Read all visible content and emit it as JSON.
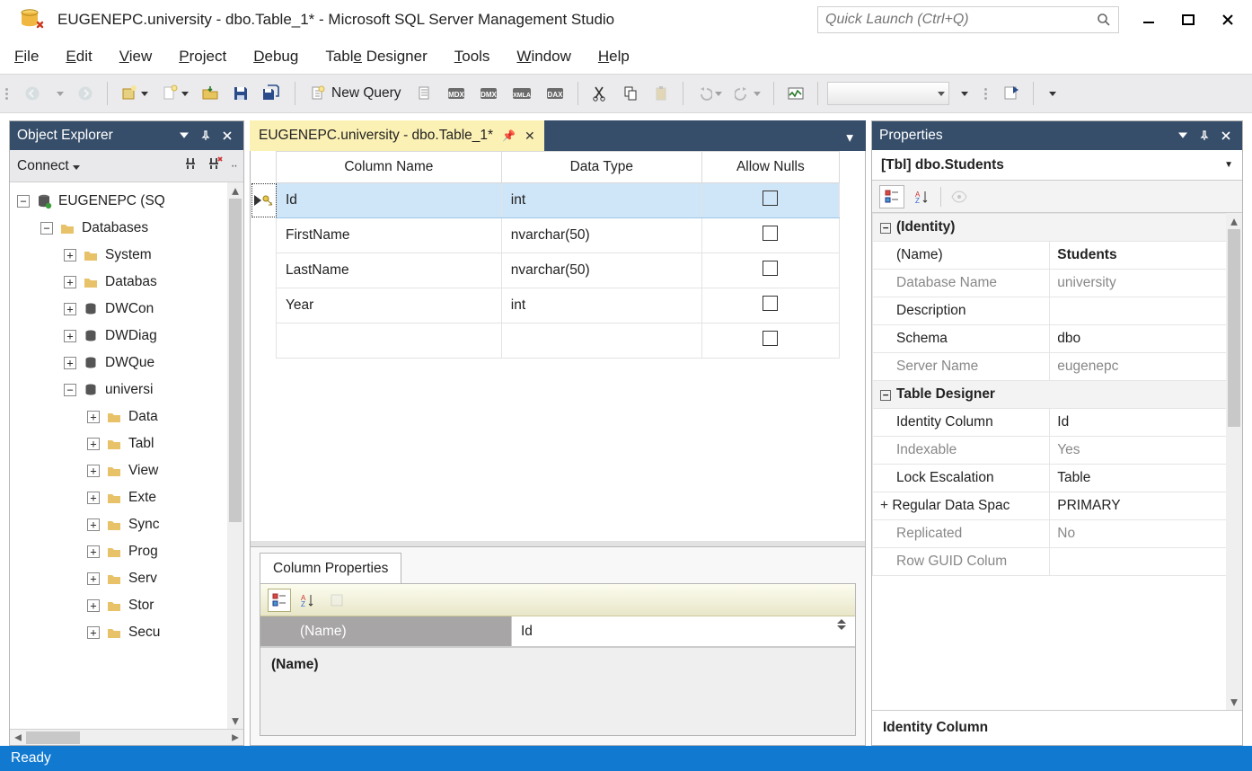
{
  "window": {
    "title": "EUGENEPC.university - dbo.Table_1* - Microsoft SQL Server Management Studio",
    "quick_launch_placeholder": "Quick Launch (Ctrl+Q)"
  },
  "menu": {
    "file": "File",
    "edit": "Edit",
    "view": "View",
    "project": "Project",
    "debug": "Debug",
    "table_designer": "Table Designer",
    "tools": "Tools",
    "window": "Window",
    "help": "Help"
  },
  "toolbar": {
    "new_query": "New Query"
  },
  "object_explorer": {
    "title": "Object Explorer",
    "connect": "Connect",
    "root": "EUGENEPC (SQ",
    "nodes": {
      "databases": "Databases",
      "system": "System",
      "databas": "Databas",
      "dwcon": "DWCon",
      "dwdiag": "DWDiag",
      "dwque": "DWQue",
      "universi": "universi",
      "data": "Data",
      "tabl": "Tabl",
      "view": "View",
      "exte": "Exte",
      "sync": "Sync",
      "prog": "Prog",
      "serv": "Serv",
      "stor": "Stor",
      "secu": "Secu"
    }
  },
  "editor": {
    "tab_title": "EUGENEPC.university - dbo.Table_1*",
    "headers": {
      "col": "Column Name",
      "type": "Data Type",
      "nulls": "Allow Nulls"
    },
    "rows": [
      {
        "name": "Id",
        "type": "int",
        "allow_nulls": false,
        "pk": true,
        "selected": true
      },
      {
        "name": "FirstName",
        "type": "nvarchar(50)",
        "allow_nulls": false,
        "pk": false,
        "selected": false
      },
      {
        "name": "LastName",
        "type": "nvarchar(50)",
        "allow_nulls": false,
        "pk": false,
        "selected": false
      },
      {
        "name": "Year",
        "type": "int",
        "allow_nulls": false,
        "pk": false,
        "selected": false
      }
    ],
    "column_properties": {
      "tab": "Column Properties",
      "row_label": "(Name)",
      "row_value": "Id",
      "help": "(Name)"
    }
  },
  "properties": {
    "title": "Properties",
    "subject": "[Tbl] dbo.Students",
    "groups": [
      {
        "name": "(Identity)",
        "expanded": true,
        "rows": [
          {
            "k": "(Name)",
            "v": "Students",
            "ro": false,
            "bold": true
          },
          {
            "k": "Database Name",
            "v": "university",
            "ro": true
          },
          {
            "k": "Description",
            "v": "",
            "ro": false
          },
          {
            "k": "Schema",
            "v": "dbo",
            "ro": false
          },
          {
            "k": "Server Name",
            "v": "eugenepc",
            "ro": true
          }
        ]
      },
      {
        "name": "Table Designer",
        "expanded": true,
        "rows": [
          {
            "k": "Identity Column",
            "v": "Id",
            "ro": false
          },
          {
            "k": "Indexable",
            "v": "Yes",
            "ro": true
          },
          {
            "k": "Lock Escalation",
            "v": "Table",
            "ro": false
          },
          {
            "k": "Regular Data Spac",
            "v": "PRIMARY",
            "ro": false,
            "expandable": true
          },
          {
            "k": "Replicated",
            "v": "No",
            "ro": true
          },
          {
            "k": "Row GUID Colum",
            "v": "",
            "ro": true
          }
        ]
      }
    ],
    "help": "Identity Column"
  },
  "status": {
    "text": "Ready"
  }
}
